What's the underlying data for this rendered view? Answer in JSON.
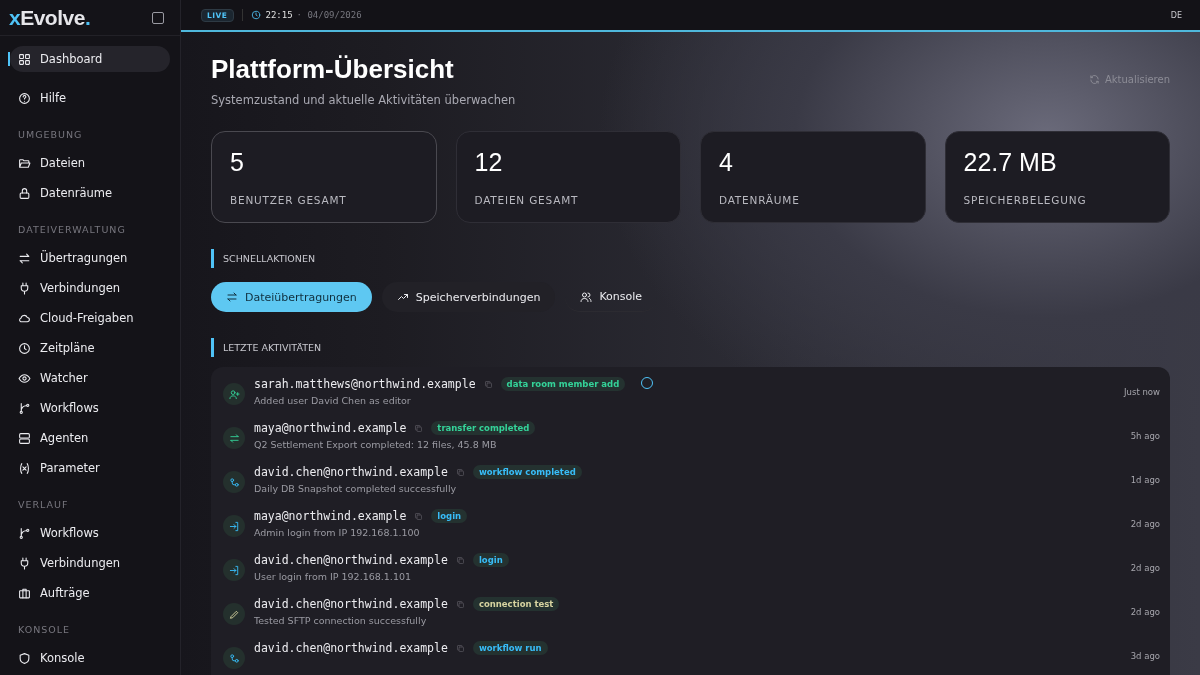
{
  "brand": {
    "name": "xEvolve",
    "dot": "."
  },
  "topbar": {
    "live": "LIVE",
    "time": "22:15",
    "separator": "·",
    "date": "04/09/2026",
    "language": "DE"
  },
  "sidebar": {
    "items": [
      {
        "label": "Dashboard",
        "selected": true
      },
      {
        "label": "Hilfe",
        "selected": false
      }
    ],
    "sections": [
      {
        "title": "UMGEBUNG",
        "items": [
          {
            "label": "Dateien",
            "selected": false
          },
          {
            "label": "Datenräume",
            "selected": false
          }
        ]
      },
      {
        "title": "DATEIVERWALTUNG",
        "items": [
          {
            "label": "Übertragungen",
            "selected": false
          },
          {
            "label": "Verbindungen",
            "selected": false
          },
          {
            "label": "Cloud-Freigaben",
            "selected": false
          },
          {
            "label": "Zeitpläne",
            "selected": false
          },
          {
            "label": "Watcher",
            "selected": false
          },
          {
            "label": "Workflows",
            "selected": false
          },
          {
            "label": "Agenten",
            "selected": false
          },
          {
            "label": "Parameter",
            "selected": false
          }
        ]
      },
      {
        "title": "VERLAUF",
        "items": [
          {
            "label": "Workflows",
            "selected": false
          },
          {
            "label": "Verbindungen",
            "selected": false
          },
          {
            "label": "Aufträge",
            "selected": false
          }
        ]
      },
      {
        "title": "KONSOLE",
        "items": [
          {
            "label": "Konsole",
            "selected": false
          }
        ]
      }
    ]
  },
  "page": {
    "title": "Plattform-Übersicht",
    "subtitle": "Systemzustand und aktuelle Aktivitäten überwachen",
    "refresh": "Aktualisieren"
  },
  "stats": [
    {
      "value": "5",
      "label": "BENUTZER GESAMT"
    },
    {
      "value": "12",
      "label": "DATEIEN GESAMT"
    },
    {
      "value": "4",
      "label": "DATENRÄUME"
    },
    {
      "value": "22.7 MB",
      "label": "SPEICHERBELEGUNG"
    }
  ],
  "quick_actions": {
    "title": "SCHNELLAKTIONEN",
    "buttons": [
      {
        "label": "Dateiübertragungen",
        "kind": "primary"
      },
      {
        "label": "Speicherverbindungen",
        "kind": "secondary"
      },
      {
        "label": "Konsole",
        "kind": "ghost"
      }
    ]
  },
  "activities": {
    "title": "LETZTE AKTIVITÄTEN",
    "rows": [
      {
        "user": "sarah.matthews@northwind.example",
        "tag": "data room member add",
        "color": "#34d399",
        "description": "Added user David Chen as editor",
        "time": "Just now"
      },
      {
        "user": "maya@northwind.example",
        "tag": "transfer completed",
        "color": "#34d399",
        "description": "Q2 Settlement Export completed: 12 files, 45.8 MB",
        "time": "5h ago"
      },
      {
        "user": "david.chen@northwind.example",
        "tag": "workflow completed",
        "color": "#38bdf8",
        "description": "Daily DB Snapshot completed successfully",
        "time": "1d ago"
      },
      {
        "user": "maya@northwind.example",
        "tag": "login",
        "color": "#38bdf8",
        "description": "Admin login from IP 192.168.1.100",
        "time": "2d ago"
      },
      {
        "user": "david.chen@northwind.example",
        "tag": "login",
        "color": "#38bdf8",
        "description": "User login from IP 192.168.1.101",
        "time": "2d ago"
      },
      {
        "user": "david.chen@northwind.example",
        "tag": "connection test",
        "color": "#d6d3a0",
        "description": "Tested SFTP connection successfully",
        "time": "2d ago"
      },
      {
        "user": "david.chen@northwind.example",
        "tag": "workflow run",
        "color": "#38bdf8",
        "time": "3d ago"
      }
    ]
  }
}
